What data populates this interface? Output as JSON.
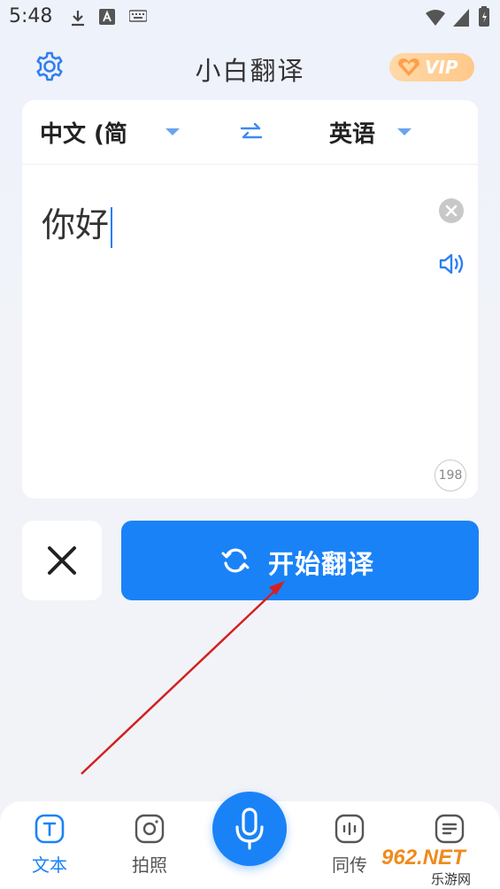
{
  "status": {
    "time": "5:48"
  },
  "header": {
    "title": "小白翻译",
    "vip_label": "VIP"
  },
  "languages": {
    "source": "中文 (简",
    "target": "英语"
  },
  "input": {
    "text": "你好",
    "char_count": "198"
  },
  "actions": {
    "translate_label": "开始翻译"
  },
  "nav": {
    "items": [
      {
        "label": "文本",
        "icon": "text-icon",
        "active": true
      },
      {
        "label": "拍照",
        "icon": "camera-icon",
        "active": false
      },
      {
        "label": "同传",
        "icon": "interpret-icon",
        "active": false
      },
      {
        "label": "",
        "icon": "document-icon",
        "active": false
      }
    ]
  },
  "watermark": {
    "text_top": "962.NET",
    "text_bottom": "乐游网"
  },
  "colors": {
    "accent": "#1a82f7",
    "vip": "#ffc88a"
  }
}
